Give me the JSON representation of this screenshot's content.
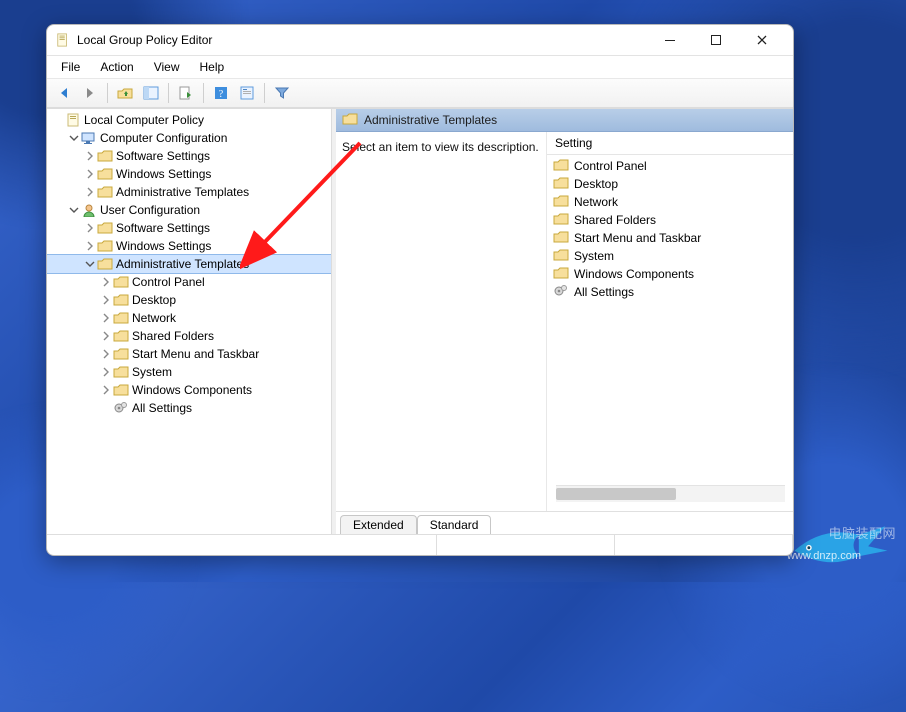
{
  "window": {
    "title": "Local Group Policy Editor"
  },
  "menu": {
    "items": [
      "File",
      "Action",
      "View",
      "Help"
    ]
  },
  "toolbar": {
    "tips": [
      "Back",
      "Forward",
      "Up",
      "Show/Hide Tree",
      "Export List",
      "Help",
      "Properties",
      "Filter"
    ]
  },
  "tree": {
    "root": "Local Computer Policy",
    "cc": "Computer Configuration",
    "cc_children": [
      "Software Settings",
      "Windows Settings",
      "Administrative Templates"
    ],
    "uc": "User Configuration",
    "uc_children": [
      "Software Settings",
      "Windows Settings",
      "Administrative Templates"
    ],
    "admin_children": [
      "Control Panel",
      "Desktop",
      "Network",
      "Shared Folders",
      "Start Menu and Taskbar",
      "System",
      "Windows Components",
      "All Settings"
    ]
  },
  "right": {
    "header": "Administrative Templates",
    "desc_prompt": "Select an item to view its description.",
    "column_header": "Setting",
    "items": [
      "Control Panel",
      "Desktop",
      "Network",
      "Shared Folders",
      "Start Menu and Taskbar",
      "System",
      "Windows Components",
      "All Settings"
    ]
  },
  "tabs": {
    "extended": "Extended",
    "standard": "Standard"
  },
  "watermark": {
    "line1": "电脑装配网",
    "line2": "www.dnzp.com"
  }
}
